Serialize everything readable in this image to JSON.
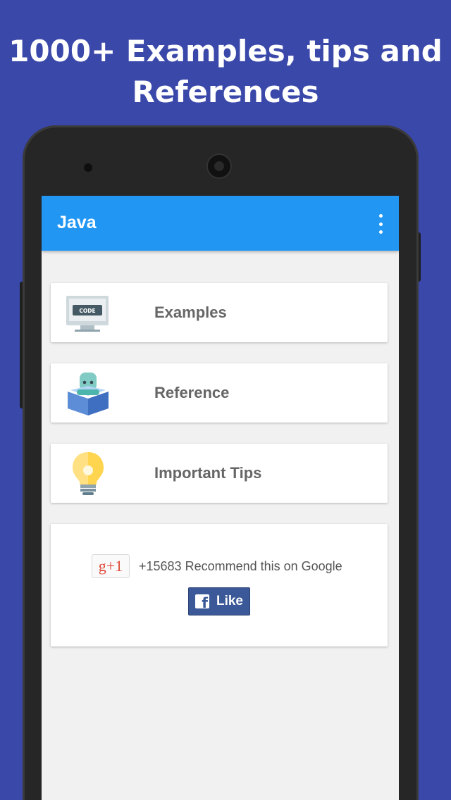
{
  "headline": {
    "line1": "1000+ Examples, tips and",
    "line2": "References"
  },
  "appbar": {
    "title": "Java",
    "overflow_icon": "more-vert-icon"
  },
  "menu": [
    {
      "label": "Examples",
      "icon": "code-monitor-icon",
      "icon_text": "CODE"
    },
    {
      "label": "Reference",
      "icon": "reader-book-icon"
    },
    {
      "label": "Important Tips",
      "icon": "lightbulb-icon"
    }
  ],
  "social": {
    "gplus_label": "g+1",
    "gplus_text": "+15683 Recommend this on Google",
    "fb_logo": "f",
    "fb_label": "Like"
  },
  "colors": {
    "background": "#3a48aa",
    "appbar": "#2196f3",
    "facebook": "#3b5998",
    "gplus": "#dd4b39"
  }
}
